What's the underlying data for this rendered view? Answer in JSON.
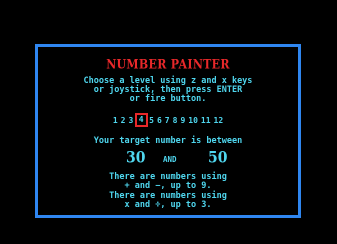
{
  "title": "NUMBER PAINTER",
  "instructions": {
    "line1": "Choose a level using z and x keys",
    "line2": "or joystick, then press ENTER",
    "line3": "or fire button."
  },
  "levels": [
    "1",
    "2",
    "3",
    "4",
    "5",
    "6",
    "7",
    "8",
    "9",
    "10",
    "11",
    "12"
  ],
  "selected_level": "4",
  "target": {
    "label": "Your target number is between",
    "low": "30",
    "conjunction": "AND",
    "high": "50"
  },
  "info": {
    "add_line1": "There are numbers using",
    "add_line2": "+ and −, up to 9.",
    "mul_line1": "There are numbers using",
    "mul_line2": "x and ÷, up to 3."
  },
  "colors": {
    "background": "#000000",
    "border": "#2f86f0",
    "title": "#e8282a",
    "text": "#4fd6ee",
    "selection": "#e8282a"
  }
}
